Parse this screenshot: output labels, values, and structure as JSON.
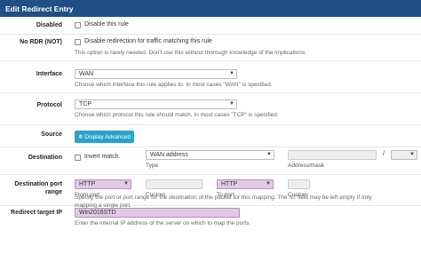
{
  "header": {
    "title": "Edit Redirect Entry"
  },
  "disabled": {
    "label": "Disabled",
    "checkbox_text": "Disable this rule"
  },
  "nordr": {
    "label": "No RDR (NOT)",
    "checkbox_text": "Disable redirection for traffic matching this rule",
    "help": "This option is rarely needed. Don't use this without thorough knowledge of the implications."
  },
  "interface": {
    "label": "Interface",
    "value": "WAN",
    "help": "Choose which interface this rule applies to. In most cases \"WAN\" is specified."
  },
  "protocol": {
    "label": "Protocol",
    "value": "TCP",
    "help": "Choose which protocol this rule should match. In most cases \"TCP\" is specified."
  },
  "source": {
    "label": "Source",
    "button": "Display Advanced"
  },
  "destination": {
    "label": "Destination",
    "invert_text": "Invert match.",
    "type_value": "WAN address",
    "type_label": "Type",
    "addr_label": "Address/mask",
    "slash": "/"
  },
  "dest_port": {
    "label_line1": "Destination port",
    "label_line2": "range",
    "from_value": "HTTP",
    "from_label": "From port",
    "custom1_label": "Custom",
    "to_value": "HTTP",
    "to_label": "To port",
    "custom2_label": "Custom",
    "help1": "Specify the port or port range for the destination of the packet for this mapping. The 'to' field may be left empty if only",
    "help2": "mapping a single port."
  },
  "redirect_ip": {
    "label": "Redirect target IP",
    "value": "Win2016STD",
    "help": "Enter the internal IP address of the server on which to map the ports."
  }
}
